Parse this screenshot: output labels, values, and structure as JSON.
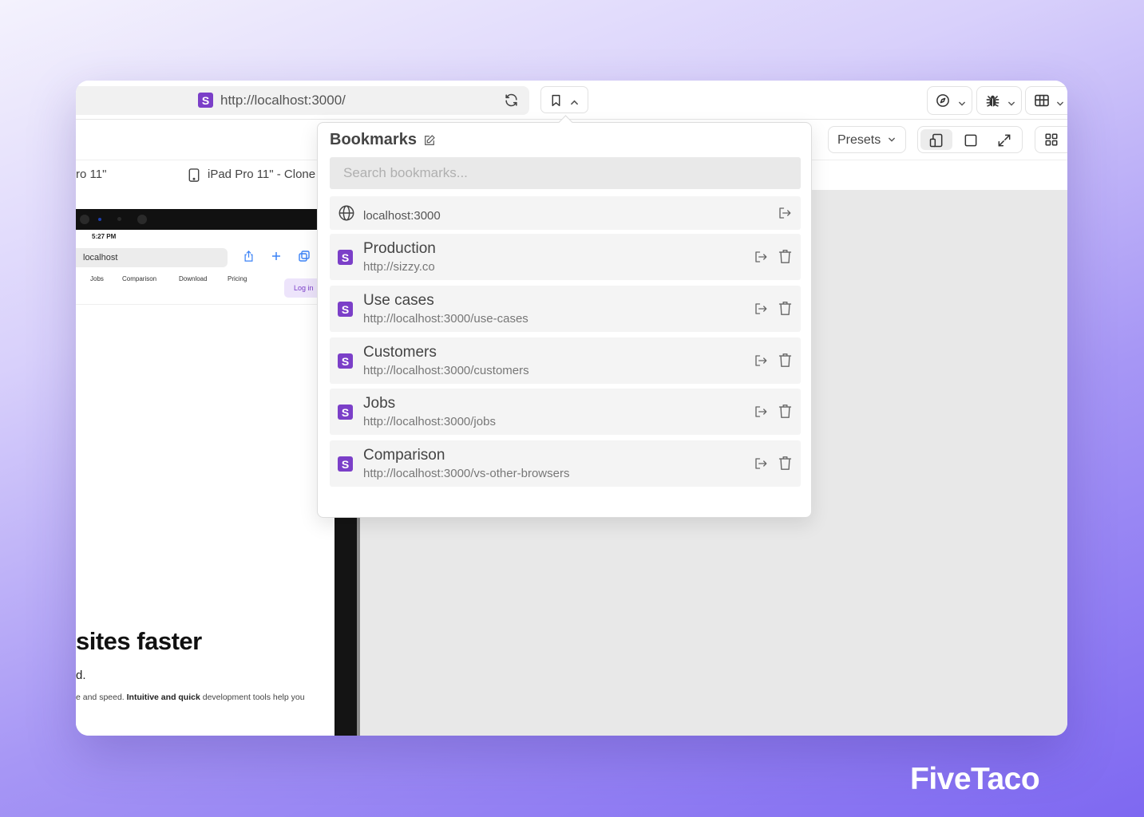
{
  "topbar": {
    "url": "http://localhost:3000/",
    "site_logo_letter": "S"
  },
  "toolbar": {
    "presets_label": "Presets"
  },
  "devices": {
    "left_label": "ro 11\"",
    "clone_label": "iPad Pro 11\" - Clone"
  },
  "preview": {
    "time": "5:27 PM",
    "url": "localhost",
    "nav": [
      "Jobs",
      "Comparison",
      "Download",
      "Pricing"
    ],
    "login": "Log in",
    "headline": "sites faster",
    "subline": "d.",
    "desc_prefix": "e and speed. ",
    "desc_bold": "Intuitive and quick",
    "desc_suffix": " development tools help you"
  },
  "bookmarks": {
    "title": "Bookmarks",
    "search_placeholder": "Search bookmarks...",
    "current_host": "localhost:3000",
    "items": [
      {
        "name": "Production",
        "url": "http://sizzy.co"
      },
      {
        "name": "Use cases",
        "url": "http://localhost:3000/use-cases"
      },
      {
        "name": "Customers",
        "url": "http://localhost:3000/customers"
      },
      {
        "name": "Jobs",
        "url": "http://localhost:3000/jobs"
      },
      {
        "name": "Comparison",
        "url": "http://localhost:3000/vs-other-browsers"
      }
    ]
  },
  "brand": "FiveTaco",
  "colors": {
    "accent": "#7b3fc8",
    "background_top": "#f4f2fd",
    "background_bottom": "#7e68f1"
  }
}
